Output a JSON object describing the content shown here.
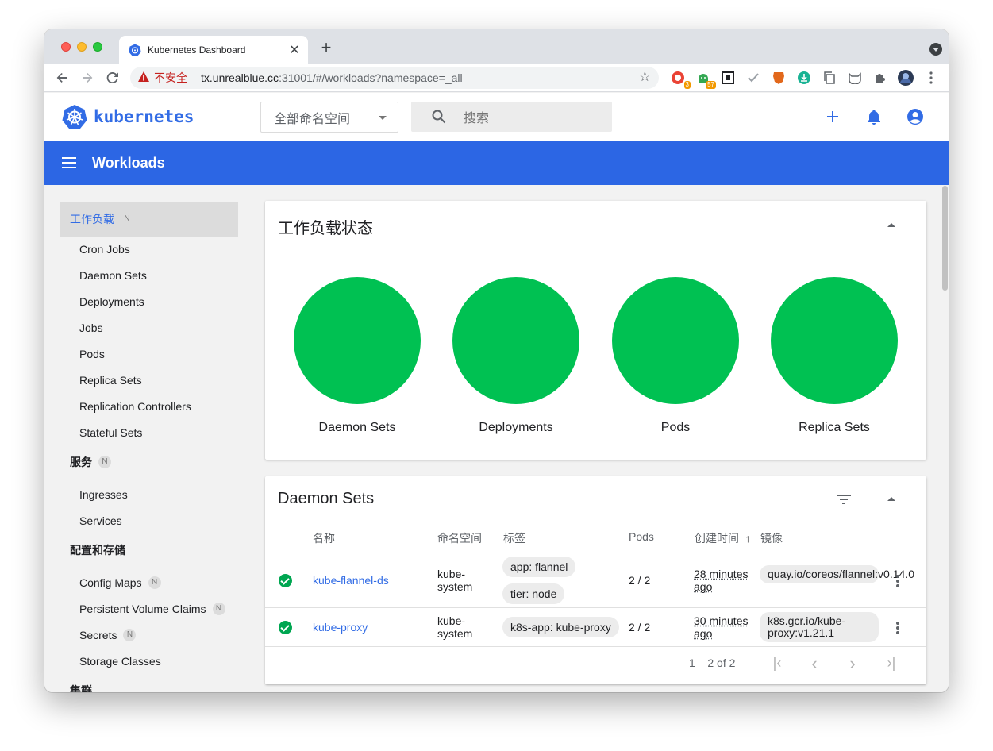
{
  "browser": {
    "tab_title": "Kubernetes Dashboard",
    "new_tab": "+",
    "security_label": "不安全",
    "url_host": "tx.unrealblue.cc",
    "url_rest": ":31001/#/workloads?namespace=_all",
    "extensions": [
      {
        "name": "recorder-extension",
        "badge": "3",
        "color": "#ea4335"
      },
      {
        "name": "android-extension",
        "badge": "57",
        "color": "#34a853"
      },
      {
        "name": "qr-extension",
        "badge": "",
        "color": "#202124"
      },
      {
        "name": "check-extension",
        "badge": "",
        "color": "#9aa0a6"
      },
      {
        "name": "brave-extension",
        "badge": "",
        "color": "#e2681b"
      },
      {
        "name": "download-extension",
        "badge": "",
        "color": "#1ab394"
      },
      {
        "name": "copy-extension",
        "badge": "",
        "color": "#5f6368"
      },
      {
        "name": "cat-extension",
        "badge": "",
        "color": "#5f6368"
      },
      {
        "name": "puzzle-extension",
        "badge": "",
        "color": "#5f6368"
      }
    ]
  },
  "header": {
    "logo_text": "kubernetes",
    "namespace_select": "全部命名空间",
    "search_placeholder": "搜索"
  },
  "toolbar": {
    "title": "Workloads"
  },
  "sidebar": {
    "workloads_group": {
      "label": "工作负载",
      "badge": "N"
    },
    "workload_items": [
      "Cron Jobs",
      "Daemon Sets",
      "Deployments",
      "Jobs",
      "Pods",
      "Replica Sets",
      "Replication Controllers",
      "Stateful Sets"
    ],
    "service_group": {
      "label": "服务",
      "badge": "N"
    },
    "service_items": [
      "Ingresses",
      "Services"
    ],
    "config_group": {
      "label": "配置和存储"
    },
    "config_items": [
      {
        "label": "Config Maps",
        "badge": "N"
      },
      {
        "label": "Persistent Volume Claims",
        "badge": "N"
      },
      {
        "label": "Secrets",
        "badge": "N"
      },
      {
        "label": "Storage Classes",
        "badge": ""
      }
    ],
    "cluster_group": {
      "label": "集群"
    }
  },
  "status_card": {
    "title": "工作负载状态",
    "circles": [
      {
        "label": "Daemon Sets",
        "color": "#00c152"
      },
      {
        "label": "Deployments",
        "color": "#00c152"
      },
      {
        "label": "Pods",
        "color": "#00c152"
      },
      {
        "label": "Replica Sets",
        "color": "#00c152"
      }
    ]
  },
  "daemon_sets": {
    "title": "Daemon Sets",
    "columns": {
      "name": "名称",
      "namespace": "命名空间",
      "labels": "标签",
      "pods": "Pods",
      "created": "创建时间",
      "sort_icon": "↑",
      "images": "镜像"
    },
    "rows": [
      {
        "name": "kube-flannel-ds",
        "namespace": "kube-\nsystem",
        "labels": [
          "app: flannel",
          "tier: node"
        ],
        "pods": "2 / 2",
        "created": "28 minutes ago",
        "image": "quay.io/coreos/flannel:v0.14.0"
      },
      {
        "name": "kube-proxy",
        "namespace": "kube-\nsystem",
        "labels": [
          "k8s-app: kube-proxy"
        ],
        "pods": "2 / 2",
        "created": "30 minutes ago",
        "image": "k8s.gcr.io/kube-proxy:v1.21.1"
      }
    ],
    "pagination": "1 – 2 of 2"
  }
}
